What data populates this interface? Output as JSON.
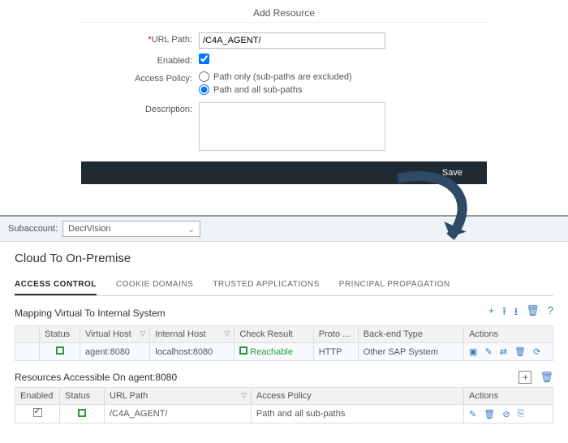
{
  "dialog": {
    "title": "Add Resource",
    "url_path_label": "URL Path:",
    "url_path_value": "/C4A_AGENT/",
    "enabled_label": "Enabled:",
    "enabled_checked": true,
    "access_policy_label": "Access Policy:",
    "policy_path_only": "Path only (sub-paths are excluded)",
    "policy_path_all": "Path and all sub-paths",
    "description_label": "Description:",
    "save_label": "Save"
  },
  "subaccount": {
    "label": "Subaccount:",
    "value": "DecIVision"
  },
  "panel_title": "Cloud To On-Premise",
  "tabs": {
    "access_control": "ACCESS CONTROL",
    "cookie_domains": "COOKIE DOMAINS",
    "trusted_apps": "TRUSTED APPLICATIONS",
    "principal_prop": "PRINCIPAL PROPAGATION"
  },
  "mapping": {
    "title": "Mapping Virtual To Internal System",
    "cols": {
      "status": "Status",
      "virtual_host": "Virtual Host",
      "internal_host": "Internal Host",
      "check_result": "Check Result",
      "proto": "Proto ...",
      "backend": "Back-end Type",
      "actions": "Actions"
    },
    "row": {
      "virtual_host": "agent:8080",
      "internal_host": "localhost:8080",
      "check_result": "Reachable",
      "proto": "HTTP",
      "backend": "Other SAP System"
    }
  },
  "resources": {
    "title": "Resources Accessible On agent:8080",
    "cols": {
      "enabled": "Enabled",
      "status": "Status",
      "url_path": "URL Path",
      "access_policy": "Access Policy",
      "actions": "Actions"
    },
    "row": {
      "url_path": "/C4A_AGENT/",
      "access_policy": "Path and all sub-paths"
    }
  }
}
